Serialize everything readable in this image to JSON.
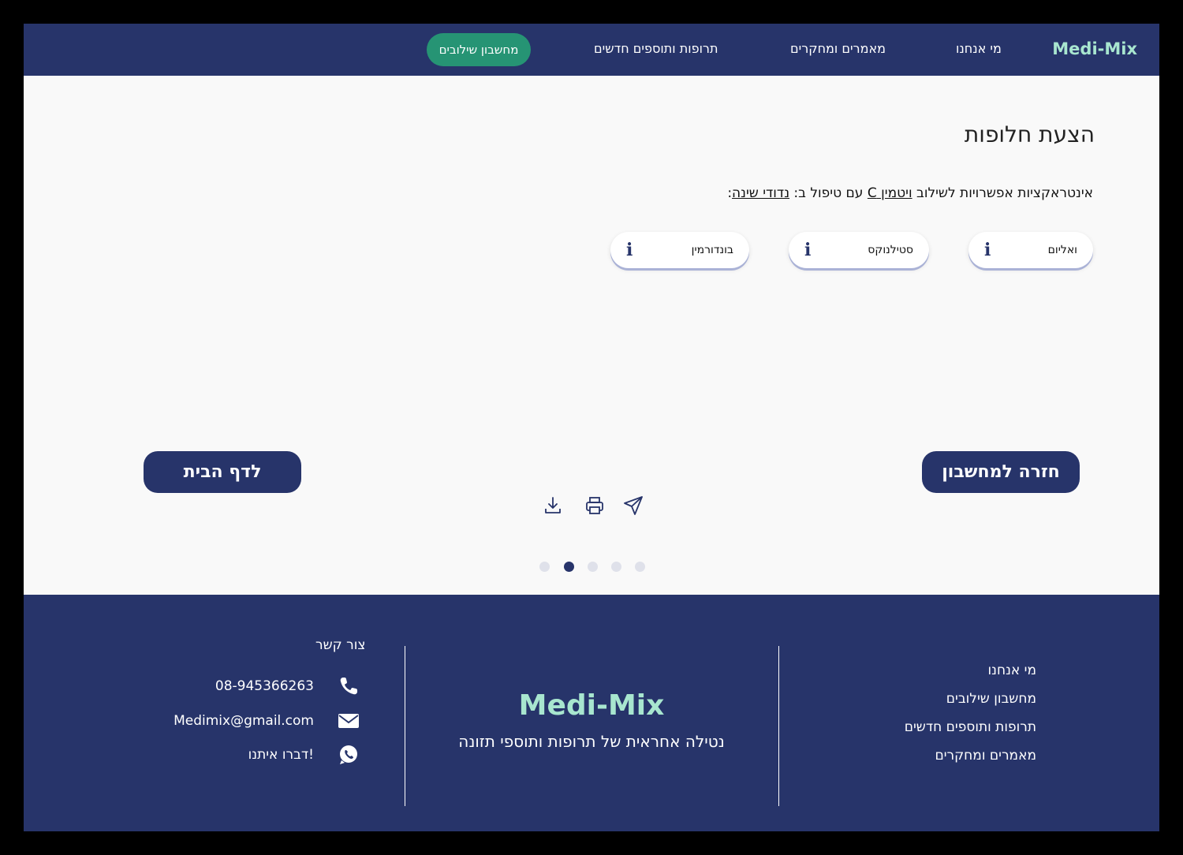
{
  "nav": {
    "brand": "Medi-Mix",
    "items": [
      "מי אנחנו",
      "מאמרים ומחקרים",
      "תרופות ותוספים חדשים"
    ],
    "cta": "מחשבון שילובים"
  },
  "main": {
    "title": "הצעת חלופות",
    "subtitle_prefix": "אינטראקציות אפשרויות לשילוב",
    "drug": "ויטמין C",
    "subtitle_mid": "עם טיפול ב:",
    "condition": "נדודי שינה",
    "subtitle_suffix": ":",
    "alternatives": [
      "ואליום",
      "סטילנוקס",
      "בונדורמין"
    ],
    "info_glyph": "i",
    "back_button": "חזרה למחשבון",
    "home_button": "לדף הבית",
    "pager": {
      "count": 5,
      "active_index": 1
    }
  },
  "footer": {
    "links": [
      "מי אנחנו",
      "מחשבון שילובים",
      "תרופות ותוספים חדשים",
      "מאמרים ומחקרים"
    ],
    "brand": "Medi-Mix",
    "tagline": "נטילה אחראית של תרופות ותוספי תזונה",
    "contact": {
      "title": "צור קשר",
      "phone": "08-945366263",
      "email": "Medimix@gmail.com",
      "whatsapp": "דברו איתנו!"
    }
  },
  "colors": {
    "navy": "#27346a",
    "mint": "#a8e6cf",
    "green": "#269474",
    "background": "#f9f9f9"
  }
}
